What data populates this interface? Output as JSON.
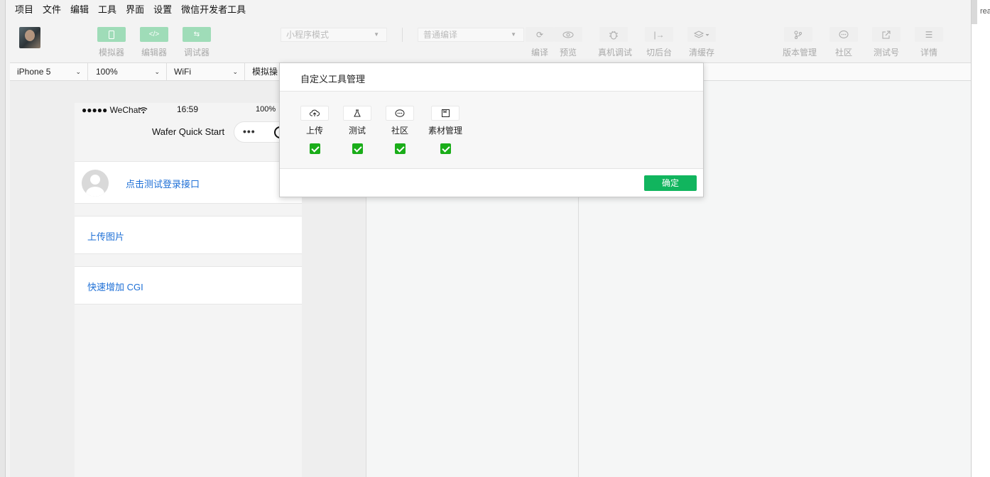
{
  "menu": [
    "项目",
    "文件",
    "编辑",
    "工具",
    "界面",
    "设置",
    "微信开发者工具"
  ],
  "toolbar": {
    "simulator": "模拟器",
    "editor": "编辑器",
    "debugger": "调试器",
    "mode_select": "小程序模式",
    "compile_select": "普通编译",
    "compile": "编译",
    "preview": "预览",
    "remote_debug": "真机调试",
    "background": "切后台",
    "clear_cache": "清缓存",
    "version": "版本管理",
    "community": "社区",
    "test_account": "测试号",
    "details": "详情"
  },
  "devbar": {
    "device": "iPhone 5",
    "zoom": "100%",
    "network": "WiFi",
    "operation": "模拟操"
  },
  "phone": {
    "signal": "●●●●● WeChat",
    "time": "16:59",
    "battery": "100%",
    "title": "Wafer Quick Start",
    "capsule_dots": "•••",
    "login": "点击测试登录接口",
    "upload": "上传图片",
    "cgi": "快速增加 CGI"
  },
  "modal": {
    "title": "自定义工具管理",
    "tools": [
      {
        "name": "上传",
        "icon": "cloud-upload-icon",
        "checked": true
      },
      {
        "name": "测试",
        "icon": "flask-icon",
        "checked": true
      },
      {
        "name": "社区",
        "icon": "chat-bubble-icon",
        "checked": true
      },
      {
        "name": "素材管理",
        "icon": "bookmark-icon",
        "checked": true
      }
    ],
    "confirm": "确定"
  },
  "right_edge_text": "rea",
  "colors": {
    "accent_green": "#1aad19",
    "button_green": "#11b55e",
    "link_blue": "#1d6fd6"
  }
}
